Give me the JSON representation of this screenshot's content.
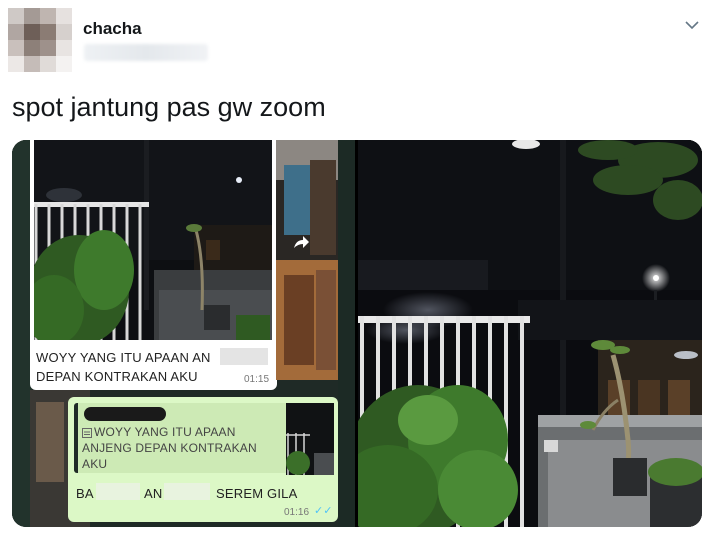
{
  "user": {
    "display_name": "chacha"
  },
  "tweet": {
    "text": "spot jantung pas gw zoom"
  },
  "chat": {
    "message1": {
      "line1": "WOYY YANG ITU APAAN AN",
      "line2": "DEPAN KONTRAKAN AKU",
      "time": "01:15"
    },
    "reply": {
      "quote_line1": "WOYY YANG ITU APAAN",
      "quote_line2": "ANJENG DEPAN KONTRAKAN",
      "quote_line3": "AKU",
      "part1": "BA",
      "part2": "AN",
      "part3": "SEREM GILA",
      "time": "01:16",
      "ticks": "✓✓"
    }
  },
  "icons": [
    "menu-chevron-down-icon",
    "forward-icon",
    "quote-icon",
    "read-receipt-icon"
  ],
  "colors": {
    "name": "#14171a",
    "chevron": "#657786",
    "bubble_white": "#ffffff",
    "bubble_green": "#dcf8c6",
    "ticks": "#4fc3f7"
  }
}
